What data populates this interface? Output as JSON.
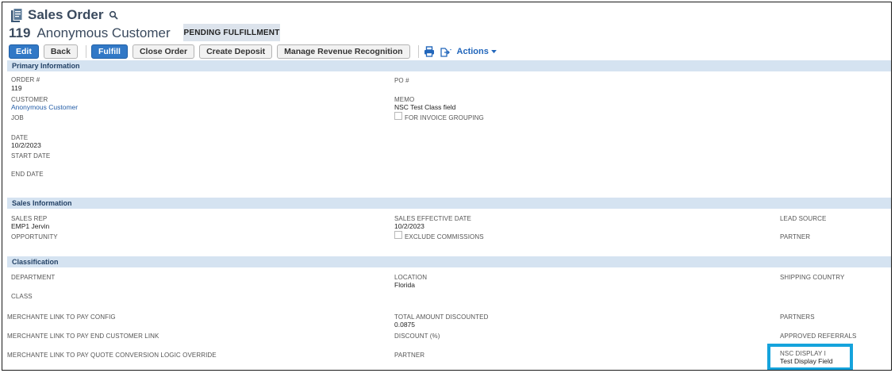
{
  "header": {
    "page_title": "Sales Order",
    "record_number": "119",
    "record_name": "Anonymous Customer",
    "status": "PENDING FULFILLMENT"
  },
  "toolbar": {
    "edit": "Edit",
    "back": "Back",
    "fulfill": "Fulfill",
    "close_order": "Close Order",
    "create_deposit": "Create Deposit",
    "manage_revenue": "Manage Revenue Recognition",
    "actions": "Actions"
  },
  "sections": {
    "primary": "Primary Information",
    "sales": "Sales Information",
    "classification": "Classification"
  },
  "primary": {
    "order_label": "ORDER #",
    "order_value": "119",
    "customer_label": "CUSTOMER",
    "customer_value": "Anonymous Customer",
    "job_label": "JOB",
    "date_label": "DATE",
    "date_value": "10/2/2023",
    "start_date_label": "START DATE",
    "end_date_label": "END DATE",
    "po_label": "PO #",
    "memo_label": "MEMO",
    "memo_value": "NSC Test Class field",
    "invoice_grouping_label": "FOR INVOICE GROUPING"
  },
  "sales": {
    "sales_rep_label": "SALES REP",
    "sales_rep_value": "EMP1 Jervin",
    "opportunity_label": "OPPORTUNITY",
    "effective_date_label": "SALES EFFECTIVE DATE",
    "effective_date_value": "10/2/2023",
    "exclude_commissions_label": "EXCLUDE COMMISSIONS",
    "lead_source_label": "LEAD SOURCE",
    "partner_label": "PARTNER"
  },
  "classification": {
    "department_label": "DEPARTMENT",
    "class_label": "CLASS",
    "location_label": "LOCATION",
    "location_value": "Florida",
    "shipping_country_label": "SHIPPING COUNTRY",
    "mlp_config_label": "MERCHANTE LINK TO PAY CONFIG",
    "mlp_end_customer_label": "MERCHANTE LINK TO PAY END CUSTOMER LINK",
    "mlp_quote_label": "MERCHANTE LINK TO PAY QUOTE CONVERSION LOGIC OVERRIDE",
    "total_discounted_label": "TOTAL AMOUNT DISCOUNTED",
    "total_discounted_value": "0.0875",
    "discount_label": "DISCOUNT (%)",
    "partner_label": "PARTNER",
    "partners_label": "PARTNERS",
    "approved_referrals_label": "APPROVED REFERRALS",
    "nsc_display_label": "NSC DISPLAY I",
    "nsc_display_value": "Test Display Field"
  },
  "colors": {
    "primary_button": "#3178c6",
    "section_bar": "#d5e3f1",
    "highlight": "#15a3dc",
    "link": "#255ea8"
  },
  "icons": [
    "document-icon",
    "search-icon",
    "print-icon",
    "export-icon",
    "chevron-down-icon"
  ]
}
